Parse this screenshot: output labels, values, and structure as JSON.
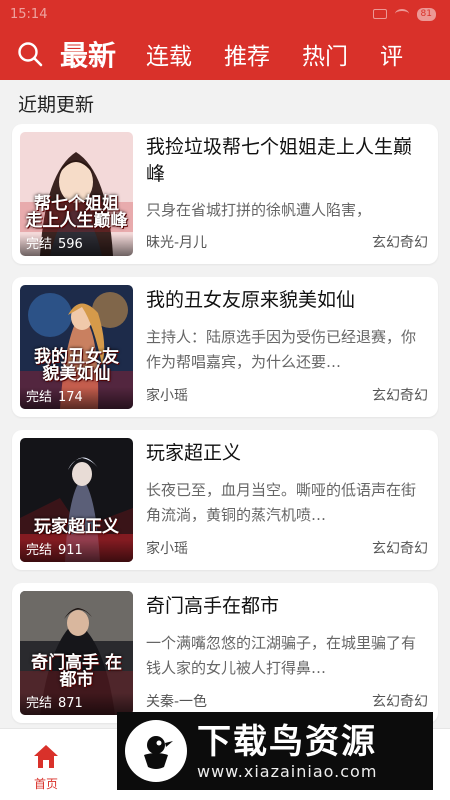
{
  "status_bar": {
    "time": "15:14",
    "battery": "81"
  },
  "header": {
    "tabs": [
      {
        "label": "最新",
        "active": true
      },
      {
        "label": "连载"
      },
      {
        "label": "推荐"
      },
      {
        "label": "热门"
      },
      {
        "label": "评"
      }
    ]
  },
  "section_title": "近期更新",
  "books": [
    {
      "title": "我捡垃圾帮七个姐姐走上人生巅峰",
      "description": "只身在省城打拼的徐帆遭人陷害，",
      "author": "昧光-月儿",
      "genre": "玄幻奇幻",
      "status": "完结",
      "chapters": "596",
      "cover_text": "帮七个姐姐 走上人生巅峰"
    },
    {
      "title": "我的丑女友原来貌美如仙",
      "description": "主持人：陆原选手因为受伤已经退赛，你作为帮唱嘉宾，为什么还要…",
      "author": "家小瑶",
      "genre": "玄幻奇幻",
      "status": "完结",
      "chapters": "174",
      "cover_text": "我的丑女友 貌美如仙"
    },
    {
      "title": "玩家超正义",
      "description": "长夜已至，血月当空。嘶哑的低语声在街角流淌，黄铜的蒸汽机喷…",
      "author": "家小瑶",
      "genre": "玄幻奇幻",
      "status": "完结",
      "chapters": "911",
      "cover_text": "玩家超正义"
    },
    {
      "title": "奇门高手在都市",
      "description": "一个满嘴忽悠的江湖骗子，在城里骗了有钱人家的女儿被人打得鼻…",
      "author": "关秦-一色",
      "genre": "玄幻奇幻",
      "status": "完结",
      "chapters": "871",
      "cover_text": "奇门高手 在都市"
    }
  ],
  "bottom_nav": {
    "home_label": "首页"
  },
  "watermark": {
    "title": "下载鸟资源",
    "url": "www.xiazainiao.com"
  },
  "colors": {
    "primary": "#d9312a",
    "background": "#f2f2f2",
    "card": "#ffffff"
  }
}
